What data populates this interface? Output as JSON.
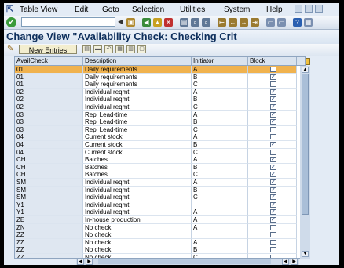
{
  "menubar": {
    "items": [
      "Table View",
      "Edit",
      "Goto",
      "Selection",
      "Utilities",
      "System",
      "Help"
    ]
  },
  "systoolbar": {
    "command_value": ""
  },
  "title": "Change View \"Availability Check: Checking Crit",
  "apptoolbar": {
    "new_entries_label": "New Entries"
  },
  "table": {
    "columns": [
      "AvailCheck",
      "Description",
      "Initiator",
      "Block"
    ],
    "rows": [
      {
        "avail": "01",
        "desc": "Daily requirements",
        "init": "A",
        "block": false,
        "selected": true
      },
      {
        "avail": "01",
        "desc": "Daily requirements",
        "init": "B",
        "block": true
      },
      {
        "avail": "01",
        "desc": "Daily requirements",
        "init": "C",
        "block": false
      },
      {
        "avail": "02",
        "desc": "Individual reqmt",
        "init": "A",
        "block": true
      },
      {
        "avail": "02",
        "desc": "Individual reqmt",
        "init": "B",
        "block": true
      },
      {
        "avail": "02",
        "desc": "Individual reqmt",
        "init": "C",
        "block": true
      },
      {
        "avail": "03",
        "desc": "Repl Lead-time",
        "init": "A",
        "block": true
      },
      {
        "avail": "03",
        "desc": "Repl Lead-time",
        "init": "B",
        "block": true
      },
      {
        "avail": "03",
        "desc": "Repl Lead-time",
        "init": "C",
        "block": false
      },
      {
        "avail": "04",
        "desc": "Current stock",
        "init": "A",
        "block": false
      },
      {
        "avail": "04",
        "desc": "Current stock",
        "init": "B",
        "block": true
      },
      {
        "avail": "04",
        "desc": "Current stock",
        "init": "C",
        "block": false
      },
      {
        "avail": "CH",
        "desc": "Batches",
        "init": "A",
        "block": true
      },
      {
        "avail": "CH",
        "desc": "Batches",
        "init": "B",
        "block": true
      },
      {
        "avail": "CH",
        "desc": "Batches",
        "init": "C",
        "block": true
      },
      {
        "avail": "SM",
        "desc": "Individual reqmt",
        "init": "A",
        "block": true
      },
      {
        "avail": "SM",
        "desc": "Individual reqmt",
        "init": "B",
        "block": true
      },
      {
        "avail": "SM",
        "desc": "Individual reqmt",
        "init": "C",
        "block": true
      },
      {
        "avail": "Y1",
        "desc": "Individual reqmt",
        "init": "",
        "block": true
      },
      {
        "avail": "Y1",
        "desc": "Individual reqmt",
        "init": "A",
        "block": true
      },
      {
        "avail": "ZE",
        "desc": "In-house production",
        "init": "A",
        "block": true
      },
      {
        "avail": "ZN",
        "desc": "No check",
        "init": "A",
        "block": false
      },
      {
        "avail": "ZZ",
        "desc": "No check",
        "init": "",
        "block": false
      },
      {
        "avail": "ZZ",
        "desc": "No check",
        "init": "A",
        "block": false
      },
      {
        "avail": "ZZ",
        "desc": "No check",
        "init": "B",
        "block": false
      },
      {
        "avail": "ZZ",
        "desc": "No check",
        "init": "C",
        "block": false
      }
    ]
  },
  "icons": {
    "enter": "check-icon",
    "save": "save-icon",
    "back": "back-icon",
    "exit": "exit-icon",
    "cancel": "cancel-icon",
    "print": "print-icon",
    "find": "find-icon",
    "settings": "table-settings-icon"
  },
  "colors": {
    "selected_row": "#f0b24e",
    "title_text": "#0e2f5c",
    "background": "#e3ebf5"
  }
}
